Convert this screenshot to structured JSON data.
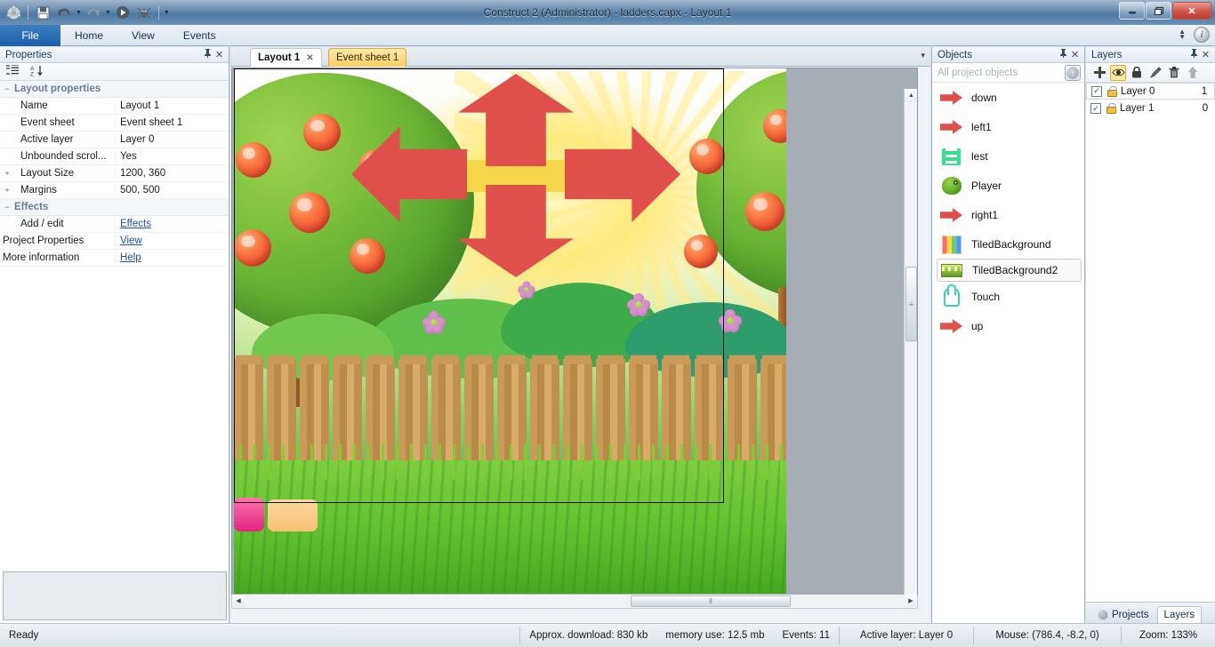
{
  "window": {
    "title": "Construct 2 (Administrator) - ladders.capx - Layout 1",
    "controls": {
      "minimize": "—",
      "maximize": "❐",
      "close": "✕"
    },
    "quick_access": [
      {
        "name": "app-menu-icon",
        "glyph": "◉"
      },
      {
        "name": "save-icon",
        "glyph": "💾"
      },
      {
        "name": "undo-icon",
        "glyph": "↶"
      },
      {
        "name": "undo-dropdown-icon",
        "glyph": "▾"
      },
      {
        "name": "redo-icon",
        "glyph": "↷"
      },
      {
        "name": "redo-dropdown-icon",
        "glyph": "▾"
      },
      {
        "name": "run-layout-icon",
        "glyph": "▶"
      },
      {
        "name": "debug-layout-icon",
        "glyph": "🐞"
      },
      {
        "name": "qat-customize-icon",
        "glyph": "▾"
      }
    ]
  },
  "ribbon": {
    "tabs": [
      {
        "label": "File",
        "active": true
      },
      {
        "label": "Home",
        "active": false
      },
      {
        "label": "View",
        "active": false
      },
      {
        "label": "Events",
        "active": false
      }
    ],
    "collapse_icon": "⬍",
    "help_icon": "i"
  },
  "properties": {
    "title": "Properties",
    "pin_icon": "⊞",
    "close_icon": "✕",
    "toolbar": [
      {
        "name": "categorized-view-icon",
        "glyph": "☰"
      },
      {
        "name": "alphabetical-sort-icon",
        "glyph": "A↓"
      }
    ],
    "groups": [
      {
        "label": "Layout properties",
        "expander": "−",
        "rows": [
          {
            "expander": "",
            "name": "Name",
            "value": "Layout 1",
            "link": false
          },
          {
            "expander": "",
            "name": "Event sheet",
            "value": "Event sheet 1",
            "link": false
          },
          {
            "expander": "",
            "name": "Active layer",
            "value": "Layer 0",
            "link": false
          },
          {
            "expander": "",
            "name": "Unbounded scrol...",
            "value": "Yes",
            "link": false
          },
          {
            "expander": "+",
            "name": "Layout Size",
            "value": "1200, 360",
            "link": false
          },
          {
            "expander": "+",
            "name": "Margins",
            "value": "500, 500",
            "link": false
          }
        ]
      },
      {
        "label": "Effects",
        "expander": "−",
        "rows": [
          {
            "expander": "",
            "name": "Add / edit",
            "value": "Effects",
            "link": true
          }
        ]
      }
    ],
    "footer_rows": [
      {
        "name": "Project Properties",
        "value": "View",
        "link": true
      },
      {
        "name": "More information",
        "value": "Help",
        "link": true
      }
    ]
  },
  "document_tabs": [
    {
      "label": "Layout 1",
      "active": true,
      "close_icon": "✕"
    },
    {
      "label": "Event sheet 1",
      "active": false,
      "close_icon": ""
    }
  ],
  "tabstrip_menu_icon": "▾",
  "canvas": {
    "scrollbars": {
      "vertical": {
        "up_icon": "▲",
        "down_icon": "▼",
        "thumb_grip": "≡"
      },
      "horizontal": {
        "left_icon": "◀",
        "right_icon": "▶",
        "thumb_grip": "⦀"
      }
    }
  },
  "objects": {
    "title": "Objects",
    "pin_icon": "⊞",
    "close_icon": "✕",
    "search_placeholder": "All project objects",
    "up_icon": "↑",
    "items": [
      {
        "label": "down",
        "icon": "arrow-object-icon",
        "selected": false
      },
      {
        "label": "left1",
        "icon": "arrow-object-icon",
        "selected": false
      },
      {
        "label": "lest",
        "icon": "ladder-object-icon",
        "selected": false
      },
      {
        "label": "Player",
        "icon": "player-sprite-icon",
        "selected": false
      },
      {
        "label": "right1",
        "icon": "arrow-object-icon",
        "selected": false
      },
      {
        "label": "TiledBackground",
        "icon": "tiled-background-icon",
        "selected": false
      },
      {
        "label": "TiledBackground2",
        "icon": "tiled-background2-icon",
        "selected": true
      },
      {
        "label": "Touch",
        "icon": "touch-plugin-icon",
        "selected": false
      },
      {
        "label": "up",
        "icon": "arrow-object-icon",
        "selected": false
      }
    ]
  },
  "layers": {
    "title": "Layers",
    "pin_icon": "⊞",
    "close_icon": "✕",
    "toolbar": [
      {
        "name": "add-layer-icon",
        "glyph": "✚",
        "active": false
      },
      {
        "name": "toggle-visibility-icon",
        "glyph": "👁",
        "active": true
      },
      {
        "name": "lock-layer-icon",
        "glyph": "🔒",
        "active": false
      },
      {
        "name": "rename-layer-icon",
        "glyph": "✎",
        "active": false
      },
      {
        "name": "delete-layer-icon",
        "glyph": "🗑",
        "active": false
      },
      {
        "name": "move-layer-up-icon",
        "glyph": "⬆",
        "active": false
      }
    ],
    "rows": [
      {
        "checked": "✓",
        "name": "Layer 0",
        "number": "1",
        "selected": true
      },
      {
        "checked": "✓",
        "name": "Layer 1",
        "number": "0",
        "selected": false
      }
    ]
  },
  "panel_tabs": [
    {
      "label": "Projects",
      "active": false,
      "icon": "projects-globe-icon"
    },
    {
      "label": "Layers",
      "active": true,
      "icon": ""
    }
  ],
  "statusbar": {
    "ready": "Ready",
    "download": "Approx. download: 830 kb",
    "memory": "memory use: 12.5 mb",
    "events": "Events: 11",
    "active_layer": "Active layer: Layer 0",
    "mouse": "Mouse: (786.4,  -8.2, 0)",
    "zoom": "Zoom: 133%"
  },
  "colors": {
    "accent": "#1d5fa8",
    "arrow_red": "#e0504a",
    "highlight_yellow": "#fde9a0",
    "link": "#1f4fa8"
  }
}
